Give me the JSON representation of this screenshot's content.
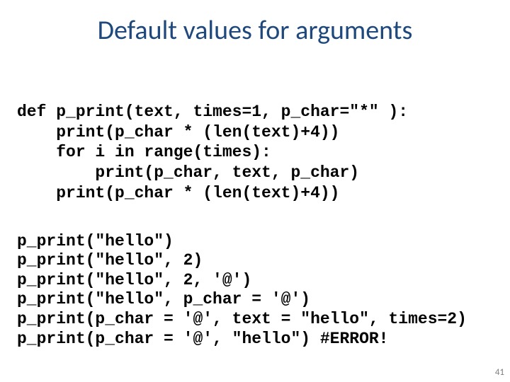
{
  "title": "Default values for arguments",
  "code": {
    "l1": "def p_print(text, times=1, p_char=\"*\" ):",
    "l2": "    print(p_char * (len(text)+4))",
    "l3": "    for i in range(times):",
    "l4": "        print(p_char, text, p_char)",
    "l5": "    print(p_char * (len(text)+4))"
  },
  "calls": {
    "c1": "p_print(\"hello\")",
    "c2": "p_print(\"hello\", 2)",
    "c3": "p_print(\"hello\", 2, '@')",
    "c4": "p_print(\"hello\", p_char = '@')",
    "c5": "p_print(p_char = '@', text = \"hello\", times=2)",
    "c6": "p_print(p_char = '@', \"hello\") #ERROR!"
  },
  "page_number": "41"
}
